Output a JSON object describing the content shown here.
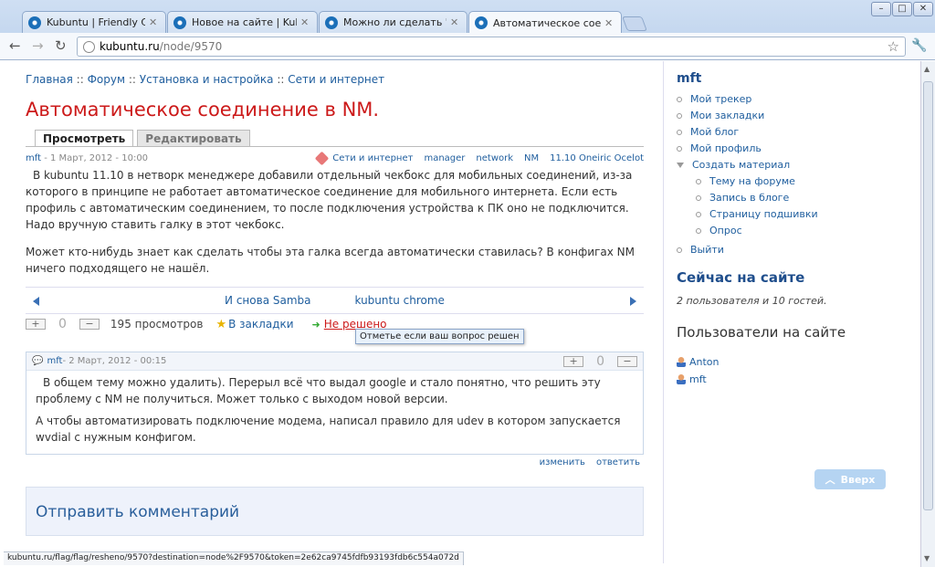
{
  "browser": {
    "tabs": [
      {
        "title": "Kubuntu | Friendly Compu"
      },
      {
        "title": "Новое на сайте | Kubuntu"
      },
      {
        "title": "Можно ли сделать \"\" кно"
      },
      {
        "title": "Автоматическое соедине"
      }
    ],
    "url_host": "kubuntu.ru",
    "url_path": "/node/9570",
    "window_buttons": [
      "–",
      "□",
      "✕"
    ]
  },
  "breadcrumb": [
    "Главная",
    "Форум",
    "Установка и настройка",
    "Сети и интернет"
  ],
  "breadcrumb_sep": "::",
  "page_title": "Автоматическое соединение в NM.",
  "view_tabs": {
    "view": "Просмотреть",
    "edit": "Редактировать"
  },
  "post": {
    "author": "mft",
    "date": " - 1 Март, 2012 - 10:00",
    "tags": [
      "Сети и интернет",
      "manager",
      "network",
      "NM",
      "11.10 Oneiric Ocelot"
    ],
    "paragraph1": "В kubuntu 11.10 в нетворк менеджере добавили отдельный чекбокс для мобильных соединений, из-за которого в принципе не работает автоматическое соединение для мобильного интернета. Если есть профиль с автоматическим соединением, то после подключения устройства к ПК оно не подключится. Надо вручную ставить галку в этот чекбокс.",
    "paragraph2": "Может кто-нибудь знает как сделать чтобы эта галка всегда автоматически ставилась? В конфигах NM ничего подходящего не нашёл."
  },
  "pager": {
    "prev": "И снова Samba",
    "next": "kubuntu chrome"
  },
  "vote": {
    "plus": "+",
    "count": "0",
    "minus": "−",
    "views": "195 просмотров",
    "bookmark": "В закладки",
    "not_solved": "Не решено"
  },
  "tooltip": "Отметье если ваш вопрос решен",
  "comment": {
    "author": "mft",
    "date": " - 2 Март, 2012 - 00:15",
    "count": "0",
    "p1": "В общем тему можно удалить). Перерыл всё что выдал google и стало понятно, что решить эту проблему с NM не получиться. Может только с выходом новой версии.",
    "p2": "А чтобы автоматизировать подключение модема, написал правило для udev в котором запускается wvdial с нужным конфигом.",
    "edit": "изменить",
    "reply": "ответить"
  },
  "send_comment": "Отправить комментарий",
  "up_button": "Вверх",
  "status_url": "kubuntu.ru/flag/flag/resheno/9570?destination=node%2F9570&token=2e62ca9745fdfb93193fdb6c554a072d",
  "sidebar": {
    "username": "mft",
    "menu": [
      "Мой трекер",
      "Мои закладки",
      "Мой блог",
      "Мой профиль",
      "Создать материал"
    ],
    "submenu": [
      "Тему на форуме",
      "Запись в блоге",
      "Страницу подшивки",
      "Опрос"
    ],
    "logout": "Выйти",
    "online_title": "Сейчас на сайте",
    "online_text": "2 пользователя и 10 гостей.",
    "users_title": "Пользователи на сайте",
    "users": [
      "Anton",
      "mft"
    ]
  }
}
